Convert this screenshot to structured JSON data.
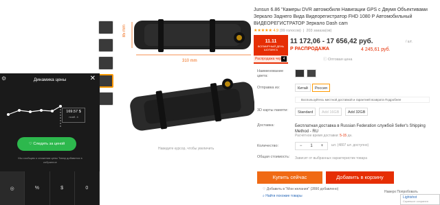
{
  "gallery": {
    "dim_vertical": "85 mm",
    "dim_horizontal": "310 mm",
    "zoom_hint": "Наведите курсор, чтобы увеличить"
  },
  "product": {
    "title": "Junsun 6.86 \"Камеры DVR автомобиля Навигации GPS с Двумя Объективами Зеркало Заднего Вида Видеорегистратор FHD 1080 P Автомобильный ВИДЕОРЕГИСТРАТОР Зеркало Dash cam",
    "rating_value": "4.9",
    "rating_count": "(99 голосов)",
    "orders": "203 заказа(ов)",
    "promo_logo": "11.11",
    "promo_text": "ВСЕМИРНЫЙ ДЕНЬ ШОПИНГА",
    "promo_timer_label": "Распродажа через",
    "promo_timer_value": "4",
    "price": "11 172,06 - 17 656,42 руб.",
    "unit": "/ шт.",
    "sale_label": "Р РАСПРОДАЖА",
    "sale_price": "4 245,61 руб.",
    "wholesale": "Оптовая цена"
  },
  "options": {
    "color_label": "Наименование цвета:",
    "ship_from_label": "Отправка из:",
    "ship_from_options": [
      "Китай",
      "Россия"
    ],
    "note": "Воспользуйтесь местной доставкой и гарантией возврата Подробнее",
    "memory_label": "3D карты памяти:",
    "memory_options": [
      "Standard",
      "Add 16GB",
      "Add 32GB"
    ],
    "delivery_label": "Доставка:",
    "delivery_text": "Бесплатная доставка в Russian Federation службой Seller's Shipping Method - RU",
    "delivery_sub_prefix": "Расчётное время доставки:",
    "delivery_days": "5-15",
    "delivery_sub_suffix": "дн.",
    "qty_label": "Количество:",
    "qty_minus": "−",
    "qty_value": "1",
    "qty_plus": "+",
    "qty_avail": "шт. (4807 шт. доступно)",
    "total_label": "Общая стоимость:",
    "total_note": "Зависит от выбранных характеристик товара"
  },
  "actions": {
    "buy": "Купить сейчас",
    "cart": "Добавить в корзину",
    "wishlist": "Добавить в \"Мои желания\" (2890 добавлено)",
    "similar": "Найти похожие товары",
    "nav_top": "Наверх Попробовать"
  },
  "lightshot": {
    "title": "Lightshot",
    "sub": "Скриншот сохранен"
  },
  "price_panel": {
    "title": "Динамика цены",
    "tooltip_price": "169.57 $",
    "tooltip_date": "нояб. 4",
    "follow_btn": "Следить за ценой",
    "note": "Мы сообщим о снижении цены Товар добавится в избранное",
    "bottom": [
      "◎",
      "%",
      "$",
      "0"
    ]
  },
  "colors": {
    "accent_orange": "#f06a14",
    "sale_red": "#e62e04",
    "panel_bg": "#1a1a1a",
    "follow_green": "#2db84d"
  }
}
